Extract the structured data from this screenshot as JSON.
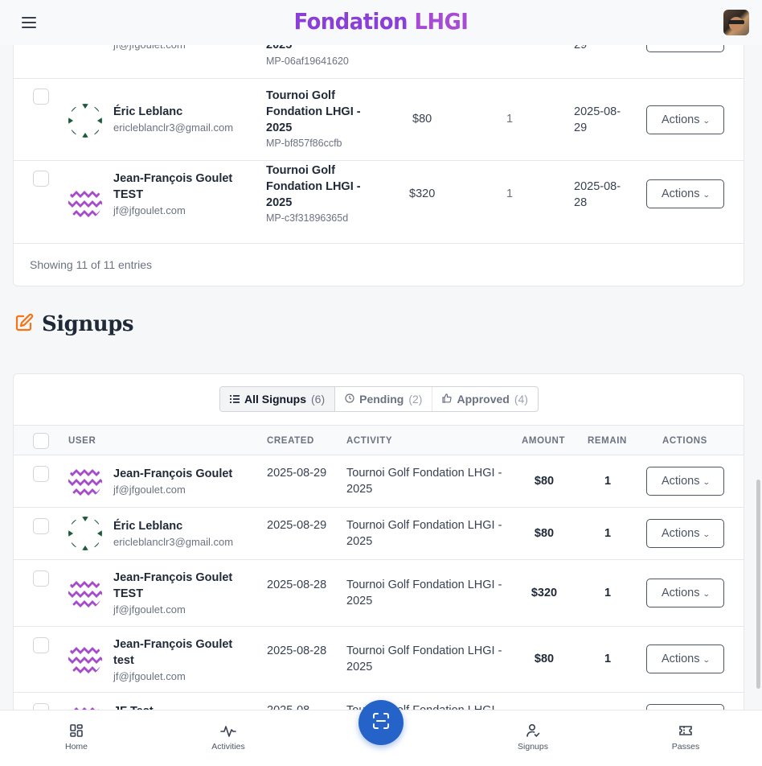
{
  "header": {
    "brand_prefix": "Fondation ",
    "brand_accent": "LHGI",
    "brand_color": "#8b3fd9"
  },
  "top_table": {
    "rows": [
      {
        "name": "",
        "email": "jf@jfgoulet.com",
        "activity": "2025",
        "code": "MP-06af19641620",
        "amount": "",
        "qty": "",
        "date": "29"
      },
      {
        "name": "Éric Leblanc",
        "email": "ericleblanclr3@gmail.com",
        "activity": "Tournoi Golf Fondation LHGI - 2025",
        "code": "MP-bf857f86ccfb",
        "amount": "$80",
        "qty": "1",
        "date": "2025-08-29"
      },
      {
        "name": "Jean-François Goulet TEST",
        "email": "jf@jfgoulet.com",
        "activity": "Tournoi Golf Fondation LHGI - 2025",
        "code": "MP-c3f31896365d",
        "amount": "$320",
        "qty": "1",
        "date": "2025-08-28"
      }
    ],
    "actions_label": "Actions",
    "showing": "Showing 11 of 11 entries"
  },
  "signups": {
    "title": "Signups",
    "tabs": [
      {
        "label": "All Signups",
        "count": "(6)"
      },
      {
        "label": "Pending",
        "count": "(2)"
      },
      {
        "label": "Approved",
        "count": "(4)"
      }
    ],
    "columns": {
      "user": "USER",
      "created": "CREATED",
      "activity": "ACTIVITY",
      "amount": "AMOUNT",
      "remain": "REMAIN",
      "actions": "ACTIONS"
    },
    "rows": [
      {
        "name": "Jean-François Goulet",
        "email": "jf@jfgoulet.com",
        "created": "2025-08-29",
        "activity": "Tournoi Golf Fondation LHGI - 2025",
        "amount": "$80",
        "remain": "1"
      },
      {
        "name": "Éric Leblanc",
        "email": "ericleblanclr3@gmail.com",
        "created": "2025-08-29",
        "activity": "Tournoi Golf Fondation LHGI - 2025",
        "amount": "$80",
        "remain": "1"
      },
      {
        "name": "Jean-François Goulet TEST",
        "email": "jf@jfgoulet.com",
        "created": "2025-08-28",
        "activity": "Tournoi Golf Fondation LHGI - 2025",
        "amount": "$320",
        "remain": "1"
      },
      {
        "name": "Jean-François Goulet test",
        "email": "jf@jfgoulet.com",
        "created": "2025-08-28",
        "activity": "Tournoi Golf Fondation LHGI - 2025",
        "amount": "$80",
        "remain": "1"
      },
      {
        "name": "JF Test",
        "email": "",
        "created": "2025-08",
        "activity": "Tournoi Golf Fondation LHGI",
        "amount": "",
        "remain": ""
      }
    ],
    "actions_label": "Actions"
  },
  "bottom_nav": {
    "items": [
      {
        "label": "Home",
        "icon": "home-grid-icon"
      },
      {
        "label": "Activities",
        "icon": "activity-pulse-icon"
      },
      {
        "label": "Signups",
        "icon": "user-check-icon"
      },
      {
        "label": "Passes",
        "icon": "ticket-icon"
      }
    ],
    "scan_icon": "scan-icon",
    "fab_color": "#2563c9"
  },
  "colors": {
    "accent_orange": "#f97316",
    "avatar_purple": "#a64bc9",
    "avatar_green": "#1e5b3c"
  }
}
